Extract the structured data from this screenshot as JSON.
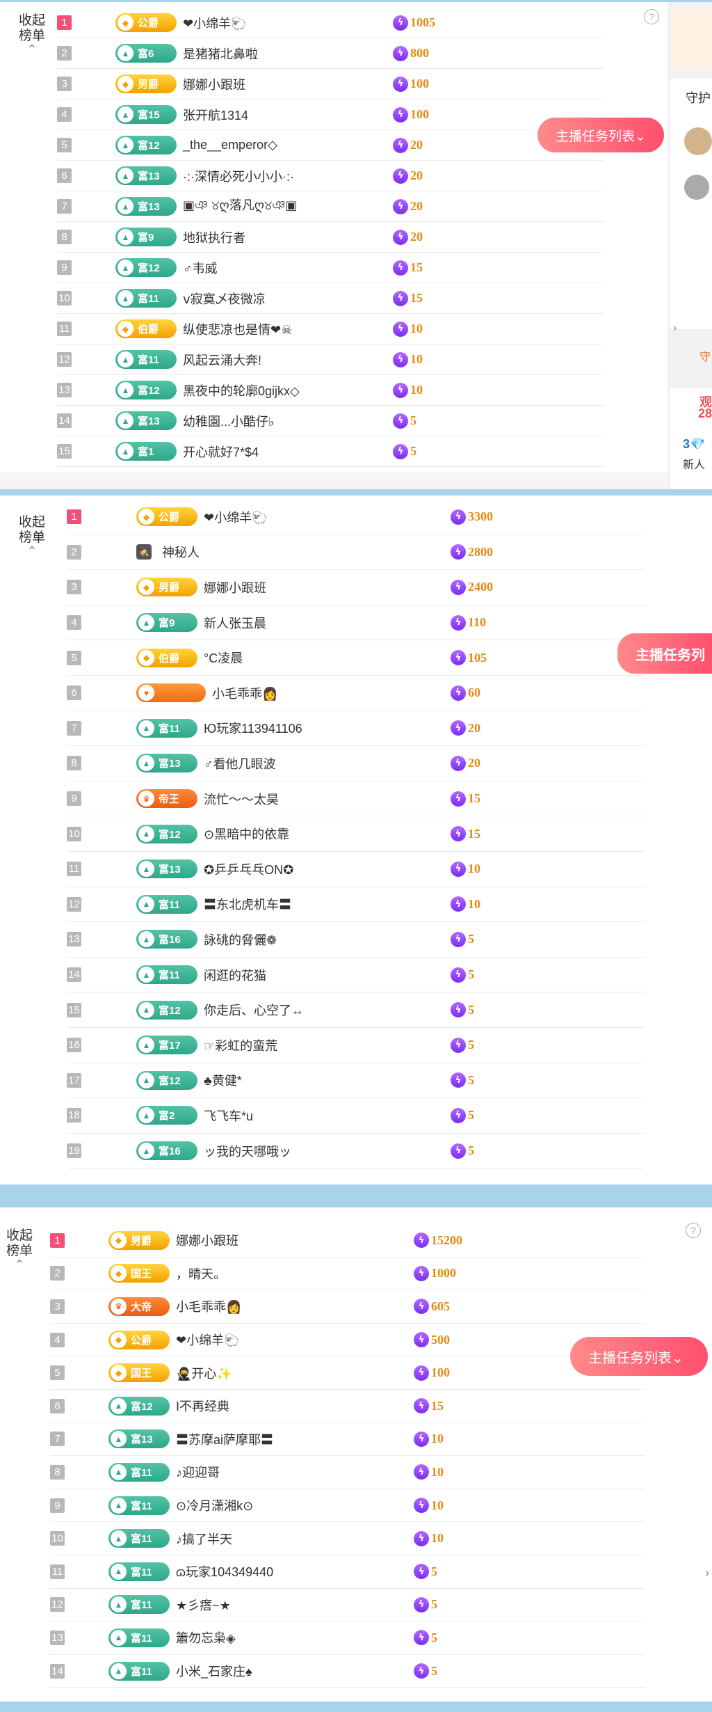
{
  "panels": [
    {
      "collapse_label": "收起\n榜单",
      "help": "?",
      "task_button": "主播任务列表⌄",
      "rows": [
        {
          "rank": "1",
          "badge": "公爵",
          "kind": "gold",
          "name": "❤小绵羊🐑",
          "score": "1005"
        },
        {
          "rank": "2",
          "badge": "富6",
          "kind": "rich",
          "name": "是猪猪北鼻啦",
          "score": "800"
        },
        {
          "rank": "3",
          "badge": "男爵",
          "kind": "gold",
          "name": "娜娜小跟班",
          "score": "100"
        },
        {
          "rank": "4",
          "badge": "富15",
          "kind": "rich",
          "name": "张开航1314",
          "score": "100"
        },
        {
          "rank": "5",
          "badge": "富12",
          "kind": "rich",
          "name": "_the__emperor◇",
          "score": "20"
        },
        {
          "rank": "6",
          "badge": "富13",
          "kind": "rich",
          "name": "·:·深情必死小小小·:·",
          "score": "20"
        },
        {
          "rank": "7",
          "badge": "富13",
          "kind": "rich",
          "name": "▣ঞ ୪ღ落凡ღ୪ঞ▣",
          "score": "20"
        },
        {
          "rank": "8",
          "badge": "富9",
          "kind": "rich",
          "name": "地狱执行者",
          "score": "20"
        },
        {
          "rank": "9",
          "badge": "富12",
          "kind": "rich",
          "name": "♂韦威",
          "score": "15"
        },
        {
          "rank": "10",
          "badge": "富11",
          "kind": "rich",
          "name": "ⅴ寂寞乄夜微凉",
          "score": "15"
        },
        {
          "rank": "11",
          "badge": "伯爵",
          "kind": "gold",
          "name": "纵使悲凉也是情❤☠",
          "score": "10"
        },
        {
          "rank": "12",
          "badge": "富11",
          "kind": "rich",
          "name": "风起云涌大奔!",
          "score": "10"
        },
        {
          "rank": "13",
          "badge": "富12",
          "kind": "rich",
          "name": "黑夜中的轮廓0gijkx◇",
          "score": "10"
        },
        {
          "rank": "14",
          "badge": "富13",
          "kind": "rich",
          "name": "幼稚園...小酷仔♭",
          "score": "5"
        },
        {
          "rank": "15",
          "badge": "富1",
          "kind": "rich",
          "name": "开心就好7*$4",
          "score": "5"
        }
      ],
      "side": {
        "guard": "守护",
        "guard2": "守",
        "watch": "观",
        "watch_num": "28",
        "fans": "3💎",
        "newbie": "新人"
      }
    },
    {
      "collapse_label": "收起\n榜单",
      "task_button": "主播任务列",
      "rows": [
        {
          "rank": "1",
          "badge": "公爵",
          "kind": "gold",
          "name": "❤小绵羊🐑",
          "score": "3300"
        },
        {
          "rank": "2",
          "badge": "",
          "kind": "myst",
          "name": "神秘人",
          "score": "2800"
        },
        {
          "rank": "3",
          "badge": "男爵",
          "kind": "gold",
          "name": "娜娜小跟班",
          "score": "2400"
        },
        {
          "rank": "4",
          "badge": "富9",
          "kind": "rich",
          "name": "新人张玉晨",
          "score": "110"
        },
        {
          "rank": "5",
          "badge": "伯爵",
          "kind": "gold",
          "name": "°C凌晨",
          "score": "105"
        },
        {
          "rank": "6",
          "badge": "",
          "kind": "orange",
          "name": "小毛乖乖👩",
          "score": "60"
        },
        {
          "rank": "7",
          "badge": "富11",
          "kind": "rich",
          "name": "Ю玩家113941106",
          "score": "20"
        },
        {
          "rank": "8",
          "badge": "富13",
          "kind": "rich",
          "name": "♂看他几眼波",
          "score": "20"
        },
        {
          "rank": "9",
          "badge": "帝王",
          "kind": "emperor",
          "name": "流忙～～太昊",
          "score": "15"
        },
        {
          "rank": "10",
          "badge": "富12",
          "kind": "rich",
          "name": "⊙黑暗中的依靠",
          "score": "15"
        },
        {
          "rank": "11",
          "badge": "富13",
          "kind": "rich",
          "name": "✪乒乒乓乓ON✪",
          "score": "10"
        },
        {
          "rank": "12",
          "badge": "富11",
          "kind": "rich",
          "name": "〓东北虎机车〓",
          "score": "10"
        },
        {
          "rank": "13",
          "badge": "富16",
          "kind": "rich",
          "name": "詠䂪的脅儷❁",
          "score": "5"
        },
        {
          "rank": "14",
          "badge": "富11",
          "kind": "rich",
          "name": "闲逛的花猫",
          "score": "5"
        },
        {
          "rank": "15",
          "badge": "富12",
          "kind": "rich",
          "name": "你走后、心空了↔",
          "score": "5"
        },
        {
          "rank": "16",
          "badge": "富17",
          "kind": "rich",
          "name": "☞彩虹的蛮荒",
          "score": "5"
        },
        {
          "rank": "17",
          "badge": "富12",
          "kind": "rich",
          "name": "♣黄健*",
          "score": "5"
        },
        {
          "rank": "18",
          "badge": "富2",
          "kind": "rich",
          "name": "飞飞车*u",
          "score": "5"
        },
        {
          "rank": "19",
          "badge": "富16",
          "kind": "rich",
          "name": "ッ我的天哪哦ッ",
          "score": "5"
        }
      ]
    },
    {
      "collapse_label": "收起\n榜单",
      "help": "?",
      "task_button": "主播任务列表⌄",
      "rows": [
        {
          "rank": "1",
          "badge": "男爵",
          "kind": "gold",
          "name": "娜娜小跟班",
          "score": "15200"
        },
        {
          "rank": "2",
          "badge": "国王",
          "kind": "gold",
          "name": "，晴天。",
          "score": "1000"
        },
        {
          "rank": "3",
          "badge": "大帝",
          "kind": "emperor",
          "name": "小毛乖乖👩",
          "score": "605"
        },
        {
          "rank": "4",
          "badge": "公爵",
          "kind": "gold",
          "name": "❤小绵羊🐑",
          "score": "500"
        },
        {
          "rank": "5",
          "badge": "国王",
          "kind": "gold",
          "name": "🥷开心✨",
          "score": "100"
        },
        {
          "rank": "6",
          "badge": "富12",
          "kind": "rich",
          "name": "I不再经典",
          "score": "15"
        },
        {
          "rank": "7",
          "badge": "富13",
          "kind": "rich",
          "name": "〓苏摩ai萨摩耶〓",
          "score": "10"
        },
        {
          "rank": "8",
          "badge": "富11",
          "kind": "rich",
          "name": "♪迎迎哥",
          "score": "10"
        },
        {
          "rank": "9",
          "badge": "富11",
          "kind": "rich",
          "name": "⊙冷月潇湘k⊙",
          "score": "10"
        },
        {
          "rank": "10",
          "badge": "富11",
          "kind": "rich",
          "name": "♪搞了半天",
          "score": "10"
        },
        {
          "rank": "11",
          "badge": "富11",
          "kind": "rich",
          "name": "ɷ玩家104349440",
          "score": "5"
        },
        {
          "rank": "12",
          "badge": "富11",
          "kind": "rich",
          "name": "★彡瘩~★",
          "score": "5"
        },
        {
          "rank": "13",
          "badge": "富11",
          "kind": "rich",
          "name": "簫勿忘枭◈",
          "score": "5"
        },
        {
          "rank": "14",
          "badge": "富11",
          "kind": "rich",
          "name": "小米_石家庄♠",
          "score": "5"
        }
      ]
    }
  ]
}
